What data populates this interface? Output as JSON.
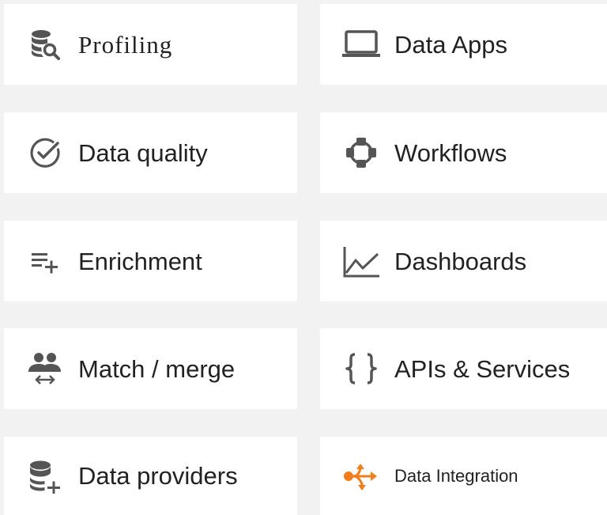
{
  "colors": {
    "icon_gray": "#555555",
    "accent_orange": "#f07d1a",
    "card_bg": "#ffffff",
    "page_bg": "#f2f2f2",
    "text": "#222222"
  },
  "tiles": [
    {
      "label": "Profiling",
      "icon": "database-search-icon"
    },
    {
      "label": "Data Apps",
      "icon": "laptop-icon"
    },
    {
      "label": "Data quality",
      "icon": "check-circle-icon"
    },
    {
      "label": "Workflows",
      "icon": "workflow-icon"
    },
    {
      "label": "Enrichment",
      "icon": "playlist-add-icon"
    },
    {
      "label": "Dashboards",
      "icon": "line-chart-icon"
    },
    {
      "label": "Match / merge",
      "icon": "people-merge-icon"
    },
    {
      "label": "APIs & Services",
      "icon": "curly-braces-icon"
    },
    {
      "label": "Data providers",
      "icon": "database-add-icon"
    },
    {
      "label": "Data Integration",
      "icon": "data-integration-icon"
    }
  ]
}
